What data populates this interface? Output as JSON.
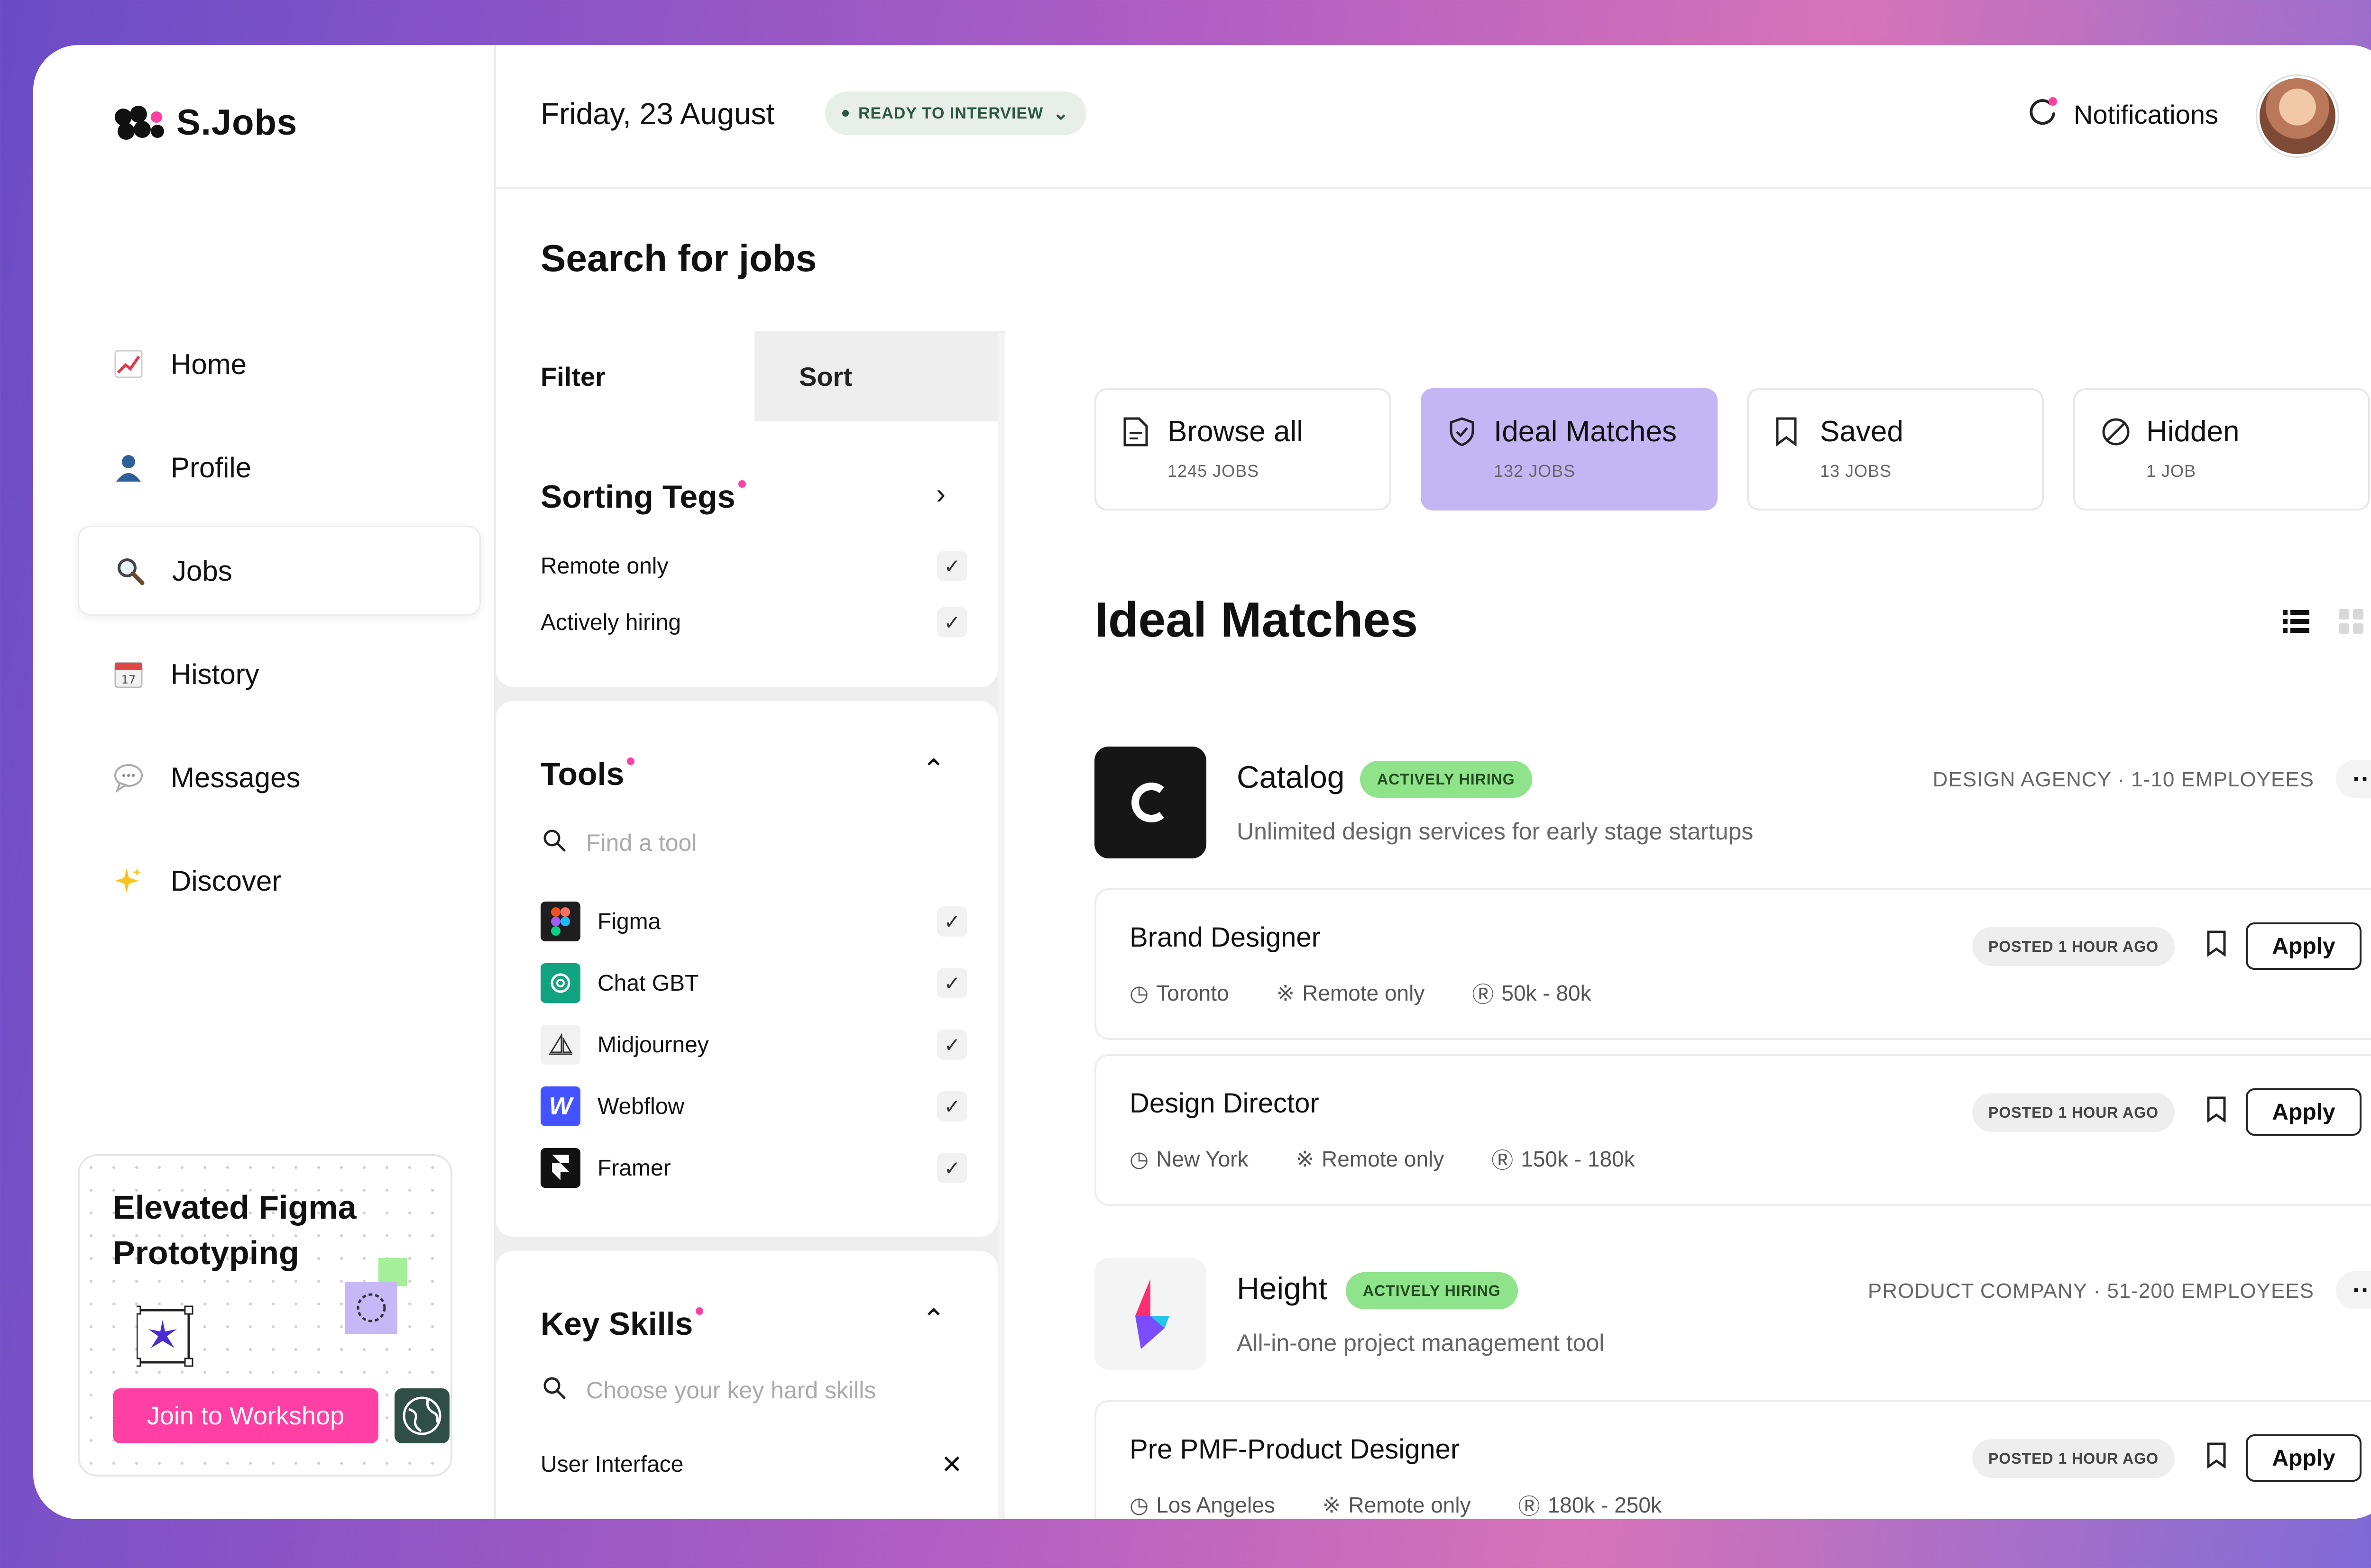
{
  "brand": {
    "name": "S.Jobs"
  },
  "header": {
    "date": "Friday, 23 August",
    "status": "READY TO INTERVIEW",
    "notifications_label": "Notifications"
  },
  "sidebar": {
    "items": [
      {
        "label": "Home",
        "icon": "chart-icon"
      },
      {
        "label": "Profile",
        "icon": "user-icon"
      },
      {
        "label": "Jobs",
        "icon": "search-icon",
        "active": true
      },
      {
        "label": "History",
        "icon": "calendar-icon"
      },
      {
        "label": "Messages",
        "icon": "chat-icon"
      },
      {
        "label": "Discover",
        "icon": "sparkles-icon"
      }
    ],
    "promo": {
      "title": "Elevated Figma Prototyping",
      "button": "Join to Workshop"
    }
  },
  "search": {
    "title": "Search for jobs"
  },
  "filters": {
    "tabs": {
      "filter": "Filter",
      "sort": "Sort"
    },
    "sorting_tags": {
      "title": "Sorting Tegs",
      "options": [
        "Remote only",
        "Actively hiring"
      ]
    },
    "tools": {
      "title": "Tools",
      "placeholder": "Find a tool",
      "items": [
        {
          "name": "Figma",
          "color": "#1e1e1e"
        },
        {
          "name": "Chat GBT",
          "color": "#10a37f"
        },
        {
          "name": "Midjourney",
          "color": "#f1f1f1"
        },
        {
          "name": "Webflow",
          "color": "#4353ff"
        },
        {
          "name": "Framer",
          "color": "#111111"
        }
      ]
    },
    "key_skills": {
      "title": "Key Skills",
      "placeholder": "Choose your key hard skills",
      "items": [
        "User Interface"
      ]
    }
  },
  "views": [
    {
      "label": "Browse all",
      "count": "1245 JOBS",
      "icon": "document-icon"
    },
    {
      "label": "Ideal Matches",
      "count": "132 JOBS",
      "icon": "shield-check-icon",
      "active": true
    },
    {
      "label": "Saved",
      "count": "13 JOBS",
      "icon": "bookmark-icon"
    },
    {
      "label": "Hidden",
      "count": "1 JOB",
      "icon": "block-icon"
    }
  ],
  "section_title": "Ideal Matches",
  "companies": [
    {
      "name": "Catalog",
      "badge": "ACTIVELY HIRING",
      "description": "Unlimited design services for early stage startups",
      "meta": "DESIGN AGENCY · 1-10 EMPLOYEES",
      "jobs": [
        {
          "title": "Brand Designer",
          "location": "Toronto",
          "remote": "Remote only",
          "salary": "50k - 80k",
          "posted": "POSTED 1 HOUR AGO",
          "apply": "Apply"
        },
        {
          "title": "Design Director",
          "location": "New York",
          "remote": "Remote only",
          "salary": "150k - 180k",
          "posted": "POSTED 1 HOUR AGO",
          "apply": "Apply"
        }
      ]
    },
    {
      "name": "Height",
      "badge": "ACTIVELY HIRING",
      "description": "All-in-one project management tool",
      "meta": "PRODUCT COMPANY · 51-200 EMPLOYEES",
      "jobs": [
        {
          "title": "Pre PMF-Product Designer",
          "location": "Los Angeles",
          "remote": "Remote only",
          "salary": "180k - 250k",
          "posted": "POSTED 1 HOUR AGO",
          "apply": "Apply"
        }
      ]
    }
  ],
  "colors": {
    "accent_purple": "#c4b6f5",
    "accent_pink": "#ff3fa4",
    "hiring_green": "#8fe38a"
  }
}
